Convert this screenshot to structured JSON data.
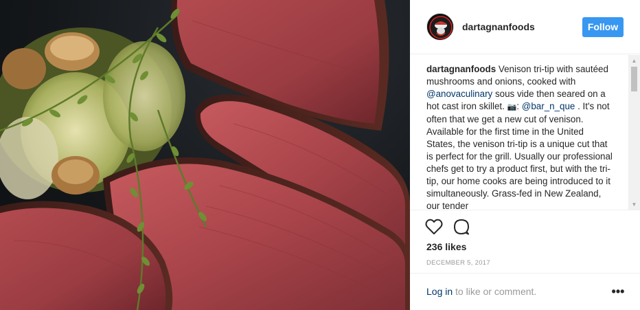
{
  "post": {
    "username": "dartagnanfoods",
    "follow_label": "Follow",
    "caption": {
      "author": "dartagnanfoods",
      "part1": " Venison tri-tip with sautéed mushrooms and onions, cooked with ",
      "mention1": "@anovaculinary",
      "part2": " sous vide then seared on a hot cast iron skillet. ",
      "camera_glyph": "📷",
      "part3": ": ",
      "mention2": "@bar_n_que",
      "part4": " . It's not often that we get a new cut of venison. Available for the first time in the United States, the venison tri-tip is a unique cut that is perfect for the grill. Usually our professional chefs get to try a product first, but with the tri-tip, our home cooks are being introduced to it simultaneously. Grass-fed in New Zealand, our tender"
    },
    "likes": "236 likes",
    "date": "December 5, 2017",
    "login_link": "Log in",
    "login_rest": " to like or comment.",
    "more_label": "•••"
  },
  "icons": {
    "like": "heart-icon",
    "comment": "comment-icon",
    "more": "more-options-icon",
    "scroll_up": "▲",
    "scroll_down": "▼"
  },
  "colors": {
    "follow_bg": "#3897f0",
    "link": "#003569",
    "muted": "#999999"
  }
}
